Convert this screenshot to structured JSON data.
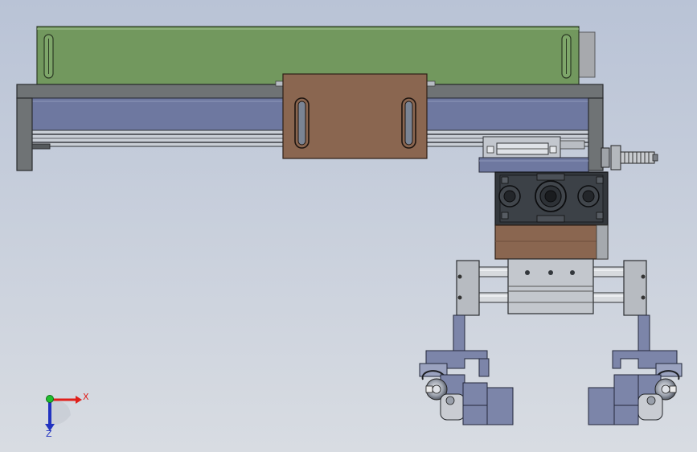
{
  "colors": {
    "background_top": "#b9c3d6",
    "background_bottom": "#d6dbe2",
    "rail_green": "#72985e",
    "beam_blue": "#6e78a0",
    "carriage_brown": "#8a6650",
    "frame_gray": "#6d7072",
    "block_dark": "#33373c",
    "gripper_blue": "#7c85a9",
    "axis_x": "#e0201a",
    "axis_y": "#1fbf2e",
    "axis_z": "#2233c0"
  },
  "triad": {
    "x_label": "X",
    "z_label": "Z"
  }
}
